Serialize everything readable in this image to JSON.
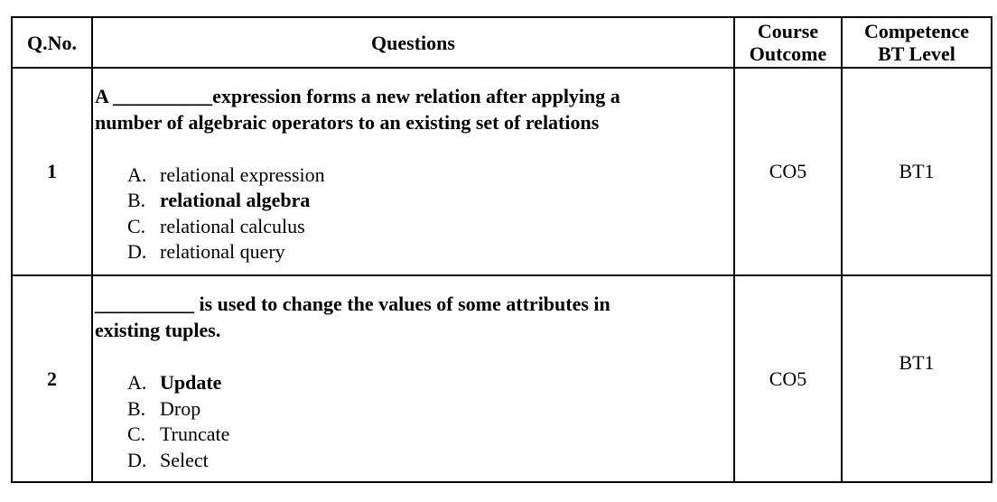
{
  "headers": {
    "qno": "Q.No.",
    "questions": "Questions",
    "course_outcome_line1": "Course",
    "course_outcome_line2": "Outcome",
    "bt_line1": "Competence",
    "bt_line2": "BT Level"
  },
  "rows": [
    {
      "number": "1",
      "stem_line1": "A __________expression forms a new relation after applying a",
      "stem_line2": "number of algebraic operators to an existing set of relations",
      "options": [
        {
          "letter": "A.",
          "text": "relational expression",
          "correct": false
        },
        {
          "letter": "B.",
          "text": "relational algebra",
          "correct": true
        },
        {
          "letter": "C.",
          "text": "relational calculus",
          "correct": false
        },
        {
          "letter": "D.",
          "text": "relational query",
          "correct": false
        }
      ],
      "course_outcome": "CO5",
      "bt_level": "BT1"
    },
    {
      "number": "2",
      "stem_line1": "__________ is used to change the values of some attributes in",
      "stem_line2": "existing tuples.",
      "options": [
        {
          "letter": "A.",
          "text": "Update",
          "correct": true
        },
        {
          "letter": "B.",
          "text": "Drop",
          "correct": false
        },
        {
          "letter": "C.",
          "text": "Truncate",
          "correct": false
        },
        {
          "letter": "D.",
          "text": "Select",
          "correct": false
        }
      ],
      "course_outcome": "CO5",
      "bt_level": "BT1"
    }
  ]
}
